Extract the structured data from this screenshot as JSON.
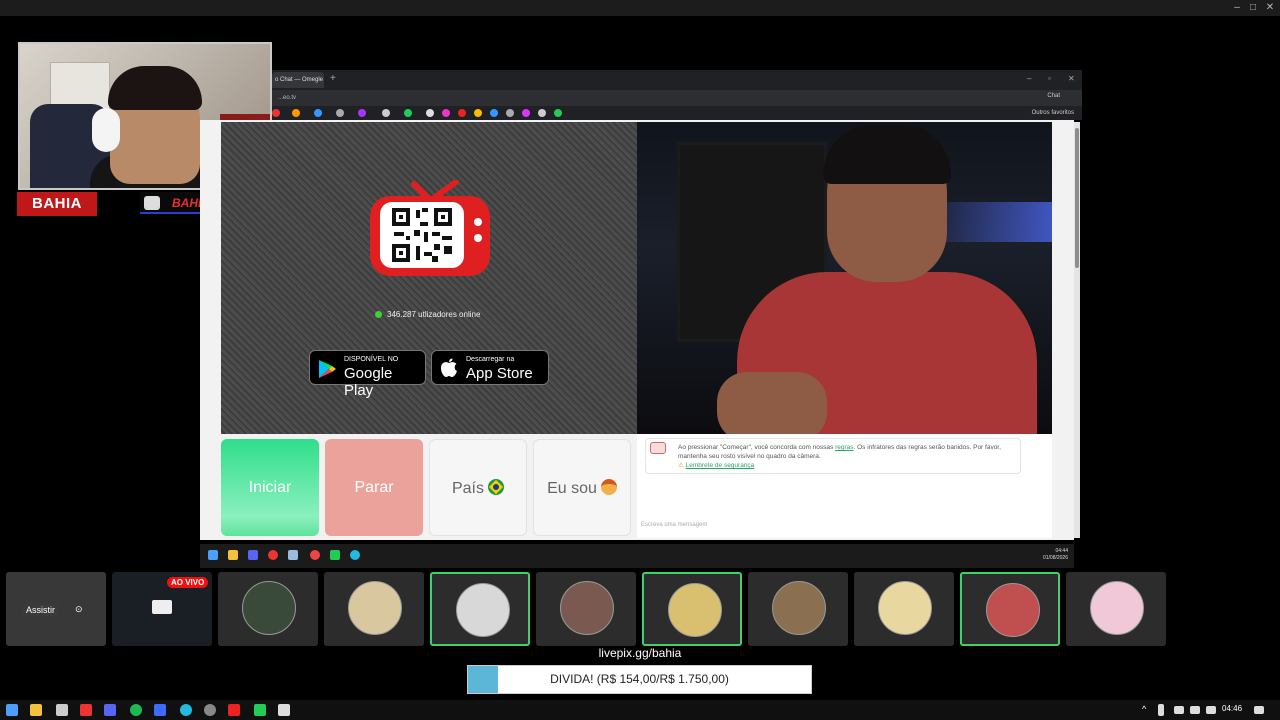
{
  "browser": {
    "tab_title": "o Chat — Omegle",
    "url": "...eo.tv",
    "chat_button": "Chat",
    "other_favorites": "Outros favoritos"
  },
  "overlay": {
    "brand_name": "BAHIA",
    "fps_label": "BAHIAFPSS"
  },
  "site": {
    "online_count": "346.287 utlizadores online",
    "google_play_small": "DISPONÍVEL NO",
    "google_play_big": "Google Play",
    "app_store_small": "Descarregar na",
    "app_store_big": "App Store",
    "start_label": "Iniciar",
    "stop_label": "Parar",
    "country_label": "País",
    "iam_label": "Eu sou",
    "notice_text_1": "Ao pressionar \"Começar\", você concorda com nossas ",
    "notice_rules_link": "regras",
    "notice_text_2": ". Os infratores das regras serão banidos. Por favor, mantenha seu rosto visível no quadro da câmera.",
    "safety_link": "Lembrete de segurança",
    "chat_placeholder": "Escreva uma mensagem"
  },
  "inner_taskbar": {
    "time": "04:44",
    "date": "01/08/2026"
  },
  "strip": {
    "assistir_label": "Assistir",
    "live_badge": "AO VIVO",
    "tiles": [
      {
        "name": "tile-1",
        "active": false,
        "avatar_color": "#3a4a3a"
      },
      {
        "name": "tile-2",
        "active": false,
        "avatar_color": "#d9c7a0"
      },
      {
        "name": "tile-3",
        "active": true,
        "avatar_color": "#d8d8d8"
      },
      {
        "name": "tile-4",
        "active": false,
        "avatar_color": "#7a5a50"
      },
      {
        "name": "tile-5",
        "active": true,
        "avatar_color": "#d8c070"
      },
      {
        "name": "tile-6",
        "active": false,
        "avatar_color": "#8a7050"
      },
      {
        "name": "tile-7",
        "active": false,
        "avatar_color": "#e8d8a0"
      },
      {
        "name": "tile-8",
        "active": true,
        "avatar_color": "#c05050"
      },
      {
        "name": "tile-9",
        "active": false,
        "avatar_color": "#f0c8d8"
      }
    ]
  },
  "donation": {
    "url": "livepix.gg/bahia",
    "goal_text": "DIVIDA! (R$ 154,00/R$ 1.750,00)",
    "progress_fraction": 0.088
  },
  "taskbar": {
    "time": "04:46"
  }
}
